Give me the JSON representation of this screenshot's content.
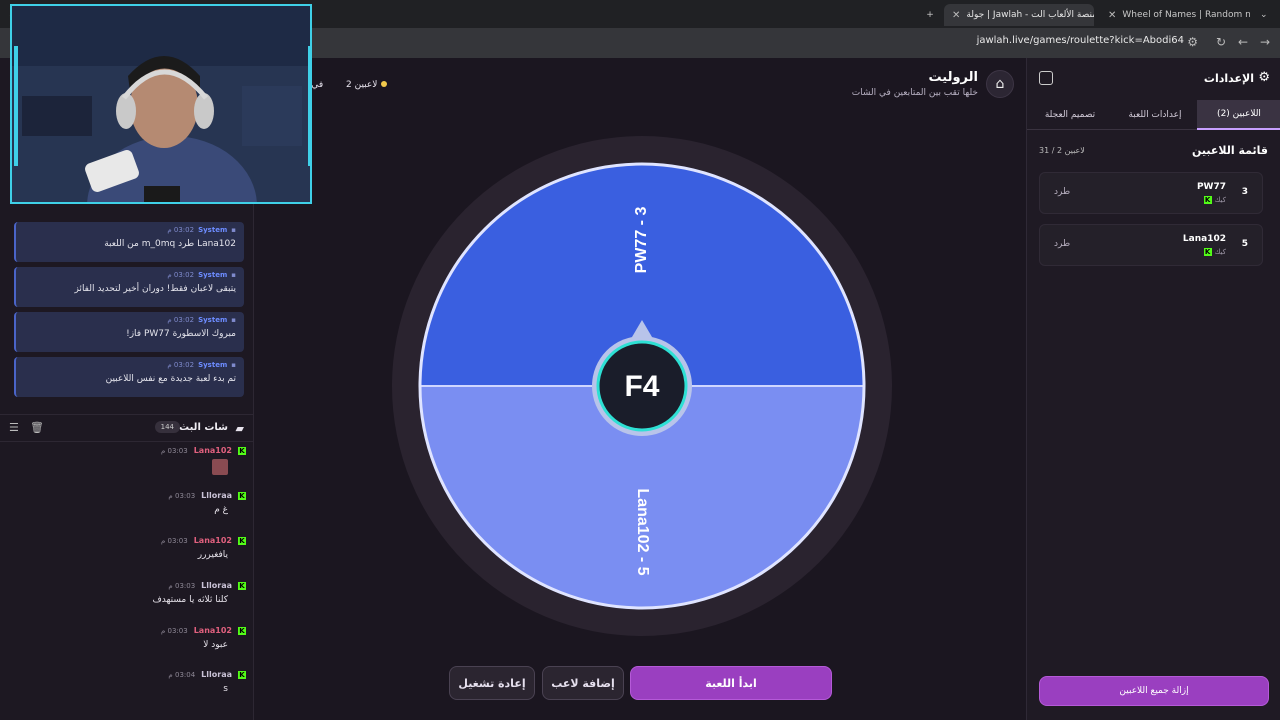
{
  "browser": {
    "tabs": [
      {
        "label": "جولة | Jawlah - منصة الألعاب الت"
      },
      {
        "label": "Wheel of Names | Random nam"
      }
    ],
    "url": "jawlah.live/games/roulette?kick=Abodi64"
  },
  "header": {
    "title": "الروليت",
    "subtitle": "خلها تقب بين المتابعين في الشات",
    "players_count": "2 لاعبين",
    "in_label": "في ا"
  },
  "system_messages": [
    {
      "who": "System",
      "time": "03:02 م",
      "text": "Lana102 طرد m_0mq من اللعبة"
    },
    {
      "who": "System",
      "time": "03:02 م",
      "text": "يتبقى لاعبان فقط! دوران أخير لتحديد الفائز"
    },
    {
      "who": "System",
      "time": "03:02 م",
      "text": "مبروك الاسطورة PW77 فاز!"
    },
    {
      "who": "System",
      "time": "03:02 م",
      "text": "تم بدء لعبة جديدة مع نفس اللاعبين"
    }
  ],
  "chat": {
    "title": "شات البث",
    "count": "144",
    "messages": [
      {
        "name": "Lana102",
        "time": "03:03 م",
        "text": "",
        "color": "#e0607e"
      },
      {
        "name": "Llloraa",
        "time": "03:03 م",
        "text": "غ م",
        "color": "#c9c2d6"
      },
      {
        "name": "Lana102",
        "time": "03:03 م",
        "text": "يافغيررر",
        "color": "#e0607e"
      },
      {
        "name": "Llloraa",
        "time": "03:03 م",
        "text": "كلنا ثلاثه يا مستهدف",
        "color": "#c9c2d6"
      },
      {
        "name": "Lana102",
        "time": "03:03 م",
        "text": "عبود لا",
        "color": "#e0607e"
      },
      {
        "name": "Llloraa",
        "time": "03:04 م",
        "text": "s",
        "color": "#c9c2d6"
      }
    ]
  },
  "wheel": {
    "segments": [
      {
        "label": "PW77 - 3",
        "color": "#3a5fe0"
      },
      {
        "label": "Lana102 - 5",
        "color": "#7a8ef2"
      }
    ],
    "center_logo": "F4"
  },
  "buttons": {
    "start": "ابدأ اللعبة",
    "add_player": "إضافة لاعب",
    "reset": "إعادة تشغيل"
  },
  "settings": {
    "title": "الإعدادات",
    "tabs": [
      "اللاعبين (2)",
      "إعدادات اللعبة",
      "تصميم العجلة"
    ],
    "list_title": "قائمة اللاعبين",
    "list_count": "31 / 2 لاعبين",
    "players": [
      {
        "name": "PW77",
        "platform": "كيك",
        "number": "3",
        "kick_label": "طرد"
      },
      {
        "name": "Lana102",
        "platform": "كيك",
        "number": "5",
        "kick_label": "طرد"
      }
    ],
    "remove_all": "إزالة جميع اللاعبين"
  },
  "colors": {
    "accent": "#9a3fc0",
    "wheel_top": "#3a5fe0",
    "wheel_bottom": "#7a8ef2",
    "kick_green": "#53fc18"
  }
}
